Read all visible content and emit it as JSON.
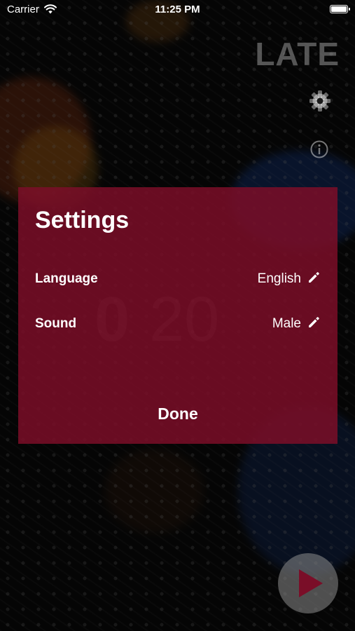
{
  "status_bar": {
    "carrier": "Carrier",
    "time": "11:25 PM"
  },
  "app": {
    "logo_text": "LATE"
  },
  "timer": {
    "hours": "0",
    "minutes": "20"
  },
  "settings": {
    "title": "Settings",
    "language_label": "Language",
    "language_value": "English",
    "sound_label": "Sound",
    "sound_value": "Male",
    "done_label": "Done"
  },
  "icons": {
    "settings": "gear-icon",
    "info": "info-icon",
    "edit": "pencil-icon",
    "play": "play-icon",
    "wifi": "wifi-icon",
    "battery": "battery-icon"
  },
  "colors": {
    "dialog_bg": "#7a0e28",
    "play_triangle": "#7a0e28"
  }
}
